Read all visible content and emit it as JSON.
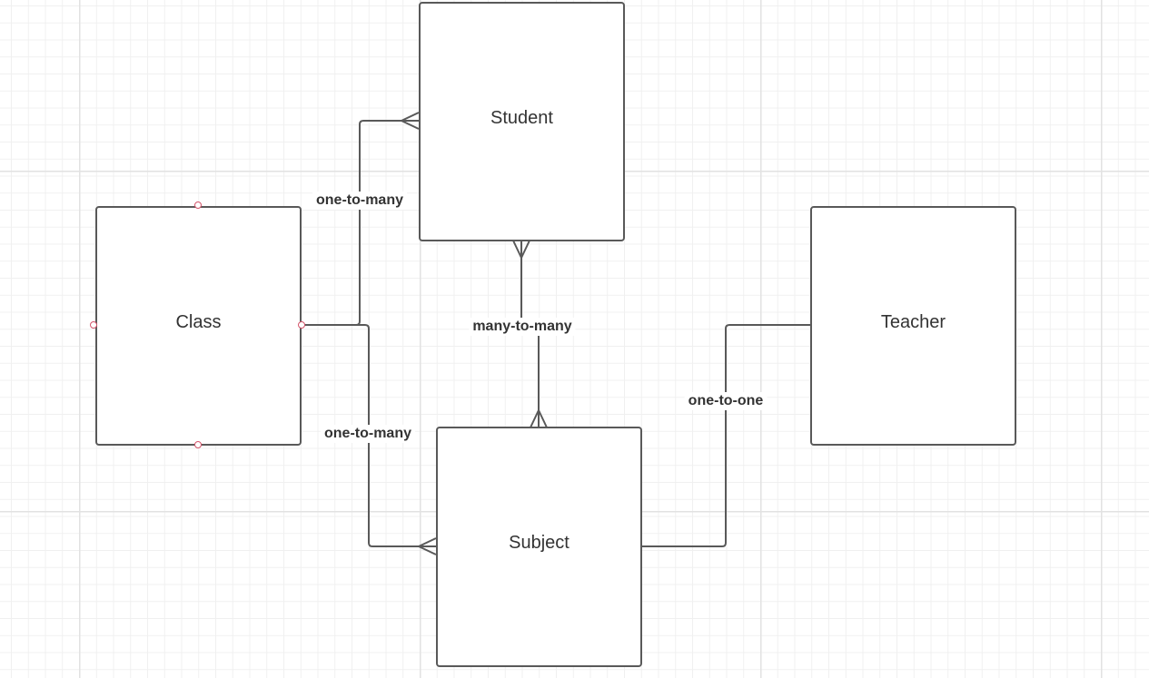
{
  "entities": {
    "class": "Class",
    "student": "Student",
    "subject": "Subject",
    "teacher": "Teacher"
  },
  "relationships": {
    "class_student": "one-to-many",
    "class_subject": "one-to-many",
    "student_subject": "many-to-many",
    "subject_teacher": "one-to-one"
  },
  "colors": {
    "line": "#595959",
    "selection_handle": "#d4546a",
    "grid_major": "#e2e2e2",
    "grid_minor": "#f0f0f0"
  }
}
